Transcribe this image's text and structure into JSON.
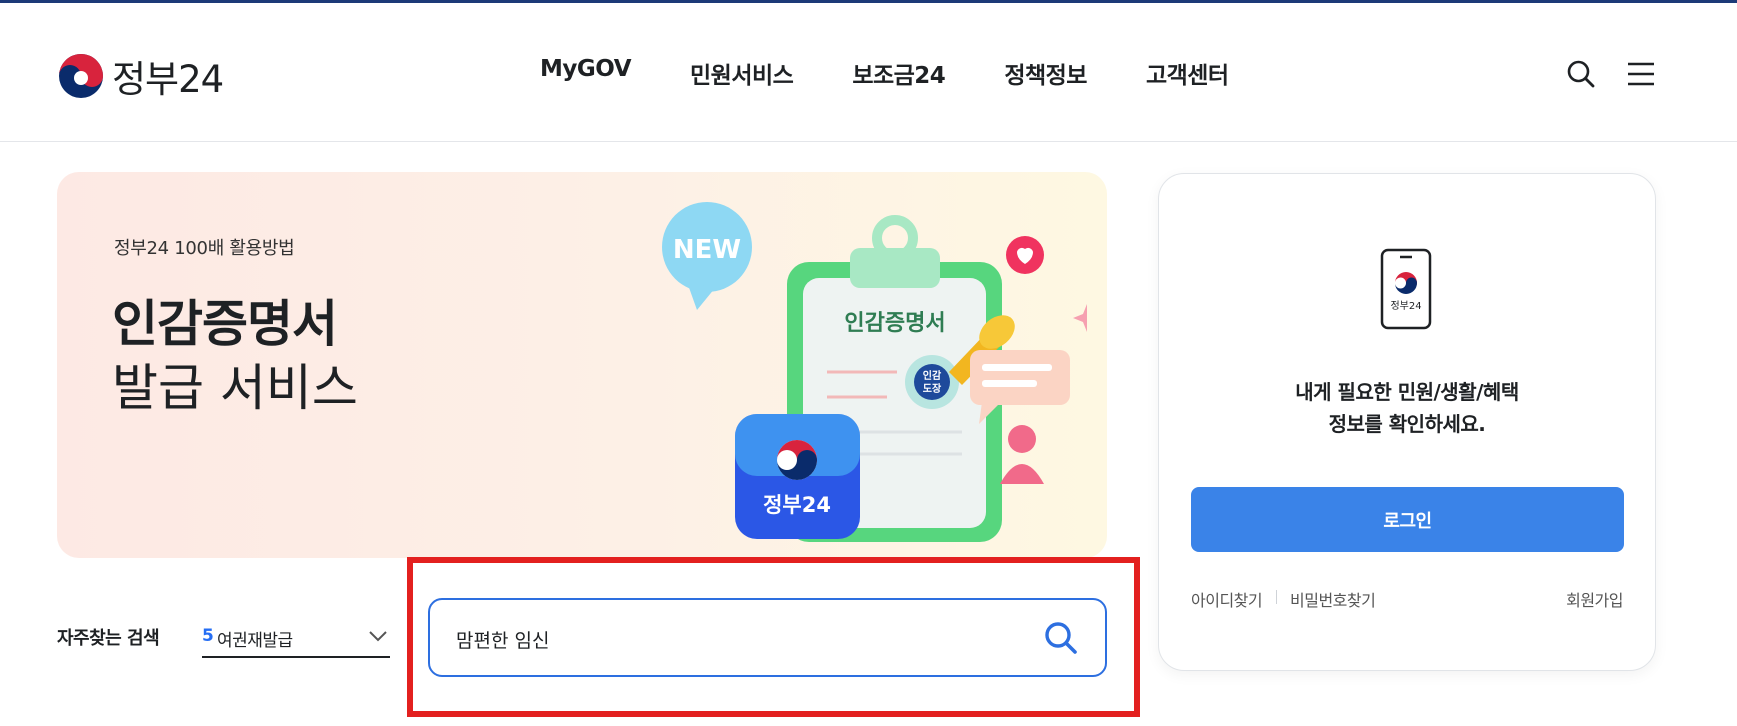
{
  "header": {
    "logo_text": "정부24",
    "nav": [
      "MyGOV",
      "민원서비스",
      "보조금24",
      "정책정보",
      "고객센터"
    ],
    "icons": [
      "search-icon",
      "menu-icon"
    ]
  },
  "banner": {
    "subtitle": "정부24 100배 활용방법",
    "title_line1": "인감증명서",
    "title_line2": "발급 서비스",
    "illust": {
      "new_bubble": "NEW",
      "clipboard_title": "인감증명서",
      "stamp_line1": "인감",
      "stamp_line2": "도장",
      "app_label": "정부24"
    }
  },
  "frequent_search": {
    "label": "자주찾는 검색",
    "rank": "5",
    "keyword": "여권재발급"
  },
  "search": {
    "value": "맘편한 임신"
  },
  "login_card": {
    "phone_label": "정부24",
    "message_line1": "내게 필요한 민원/생활/혜택",
    "message_line2": "정보를 확인하세요.",
    "login_button": "로그인",
    "find_id": "아이디찾기",
    "find_password": "비밀번호찾기",
    "signup": "회원가입"
  },
  "colors": {
    "accent_blue": "#256ef4",
    "login_button": "#3a83e8",
    "highlight_red": "#e3201f",
    "top_line": "#1d3a78"
  }
}
